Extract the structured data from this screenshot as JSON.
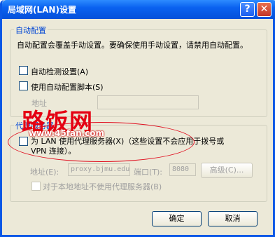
{
  "window": {
    "title": "局域网(LAN)设置",
    "help_glyph": "?",
    "close_glyph": "✕"
  },
  "auto_config": {
    "group_title": "自动配置",
    "description": "自动配置会覆盖手动设置。要确保使用手动设置，请禁用自动配置。",
    "auto_detect_label": "自动检测设置(A)",
    "script_label": "使用自动配置脚本(S)",
    "address_label": "地址",
    "address_value": ""
  },
  "proxy": {
    "group_title": "代理服务器",
    "use_proxy_line1": "为 LAN 使用代理服务器(X)（这些设置不会应用于拨号或",
    "use_proxy_line2": "VPN 连接）。",
    "address_label": "地址(E):",
    "address_value": "proxy.bjmu.edu",
    "port_label": "端口(T):",
    "port_value": "8080",
    "advanced_label": "高级(C)...",
    "bypass_label": "对于本地地址不使用代理服务器(B)"
  },
  "footer": {
    "ok_label": "确定",
    "cancel_label": "取消"
  },
  "watermark": {
    "logo": "路饭网",
    "url": "www.45fan.com"
  }
}
